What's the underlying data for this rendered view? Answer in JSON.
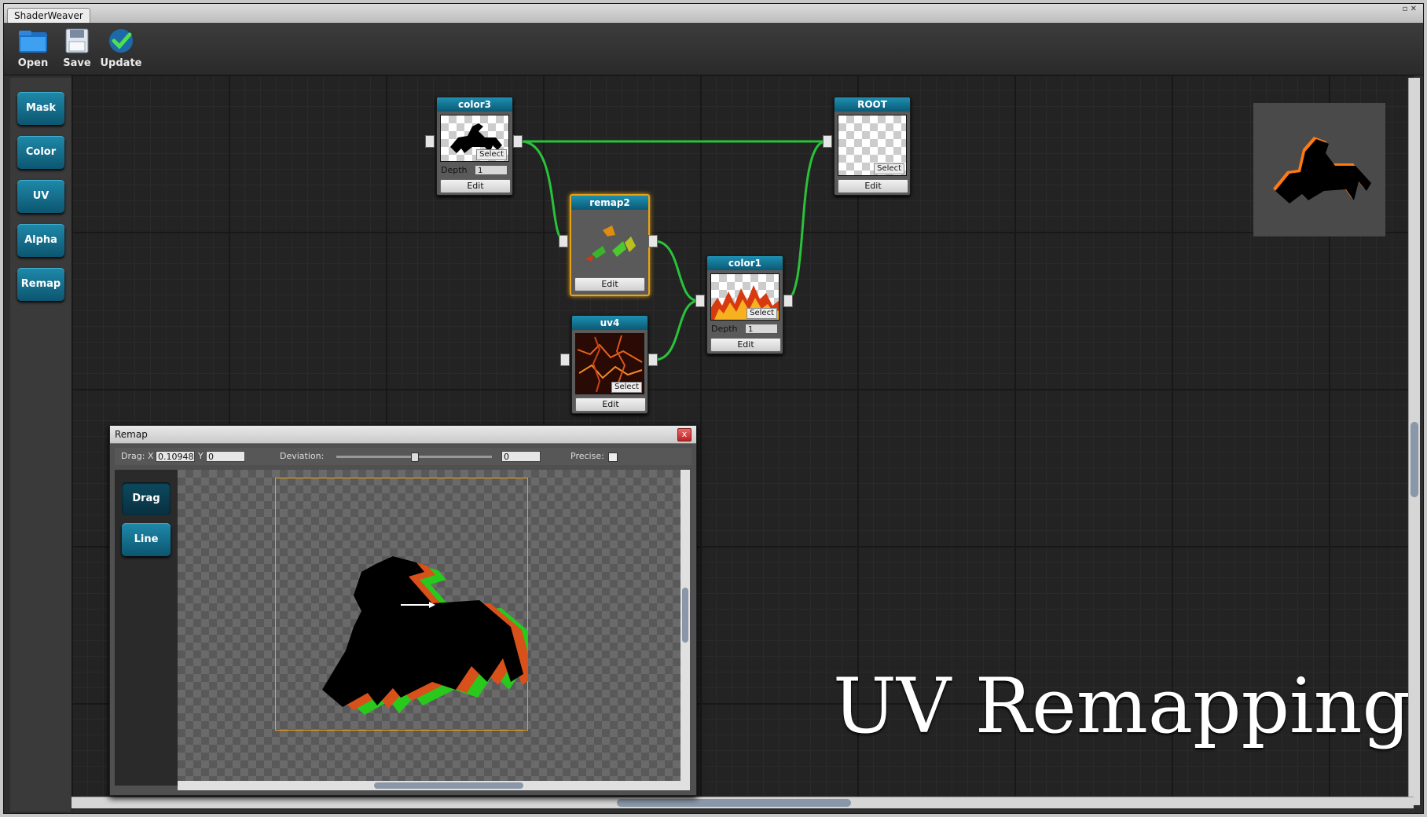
{
  "window": {
    "title": "ShaderWeaver",
    "controls": "▫ ✕"
  },
  "toolbar": {
    "open_label": "Open",
    "save_label": "Save",
    "update_label": "Update"
  },
  "sidebar": {
    "items": [
      {
        "label": "Mask"
      },
      {
        "label": "Color"
      },
      {
        "label": "UV"
      },
      {
        "label": "Alpha"
      },
      {
        "label": "Remap"
      }
    ]
  },
  "nodes": {
    "color3": {
      "title": "color3",
      "select_label": "Select",
      "depth_label": "Depth",
      "depth_value": "1",
      "edit_label": "Edit"
    },
    "root": {
      "title": "ROOT",
      "select_label": "Select",
      "edit_label": "Edit"
    },
    "remap2": {
      "title": "remap2",
      "edit_label": "Edit"
    },
    "color1": {
      "title": "color1",
      "select_label": "Select",
      "depth_label": "Depth",
      "depth_value": "1",
      "edit_label": "Edit"
    },
    "uv4": {
      "title": "uv4",
      "select_label": "Select",
      "edit_label": "Edit"
    }
  },
  "overlay_title": "UV Remapping",
  "remap_dialog": {
    "title": "Remap",
    "close": "x",
    "drag_label": "Drag:",
    "x_label": "X",
    "x_value": "0.10948",
    "y_label": "Y",
    "y_value": "0",
    "deviation_label": "Deviation:",
    "deviation_value": "0",
    "deviation_level": 0.5,
    "precise_label": "Precise:",
    "precise_checked": false,
    "tools": [
      {
        "label": "Drag"
      },
      {
        "label": "Line"
      }
    ]
  },
  "colors": {
    "accent": "#1a7fa3",
    "wire": "#29c23a",
    "selected_border": "#e8a317"
  },
  "icons": [
    "folder-icon",
    "floppy-disk-icon",
    "checkmark-icon"
  ]
}
